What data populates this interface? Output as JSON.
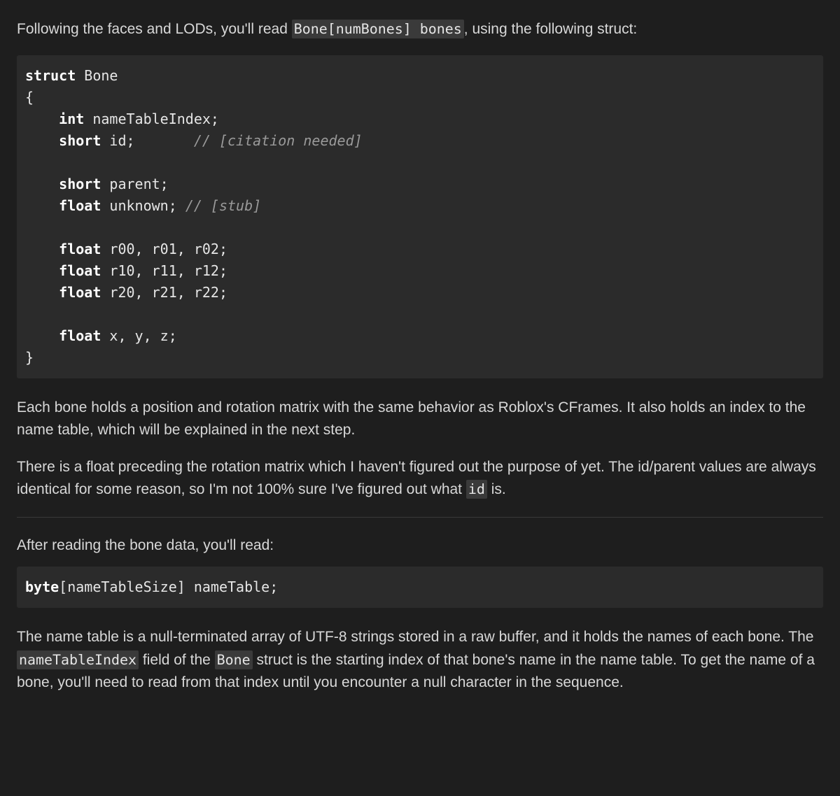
{
  "intro": {
    "pre": "Following the faces and LODs, you'll read ",
    "code": "Bone[numBones] bones",
    "post": ", using the following struct:"
  },
  "code1": {
    "l0_kw": "struct",
    "l0_rest": " Bone",
    "l1": "{",
    "l2_kw": "int",
    "l2_rest": " nameTableIndex;",
    "l3_kw": "short",
    "l3_rest": " id;       ",
    "l3_cm": "// [citation needed]",
    "l4_kw": "short",
    "l4_rest": " parent;",
    "l5_kw": "float",
    "l5_rest": " unknown; ",
    "l5_cm": "// [stub]",
    "l6_kw": "float",
    "l6_rest": " r00, r01, r02;",
    "l7_kw": "float",
    "l7_rest": " r10, r11, r12;",
    "l8_kw": "float",
    "l8_rest": " r20, r21, r22;",
    "l9_kw": "float",
    "l9_rest": " x, y, z;",
    "l10": "}",
    "indent": "    "
  },
  "p2": "Each bone holds a position and rotation matrix with the same behavior as Roblox's CFrames. It also holds an index to the name table, which will be explained in the next step.",
  "p3": {
    "pre": "There is a float preceding the rotation matrix which I haven't figured out the purpose of yet. The id/parent values are always identical for some reason, so I'm not 100% sure I've figured out what ",
    "code": "id",
    "post": " is."
  },
  "p4": "After reading the bone data, you'll read:",
  "code2": {
    "kw": "byte",
    "rest": "[nameTableSize] nameTable;"
  },
  "p5": {
    "t1": "The name table is a null-terminated array of UTF-8 strings stored in a raw buffer, and it holds the names of each bone. The ",
    "c1": "nameTableIndex",
    "t2": " field of the ",
    "c2": "Bone",
    "t3": " struct is the starting index of that bone's name in the name table. To get the name of a bone, you'll need to read from that index until you encounter a null character in the sequence."
  }
}
